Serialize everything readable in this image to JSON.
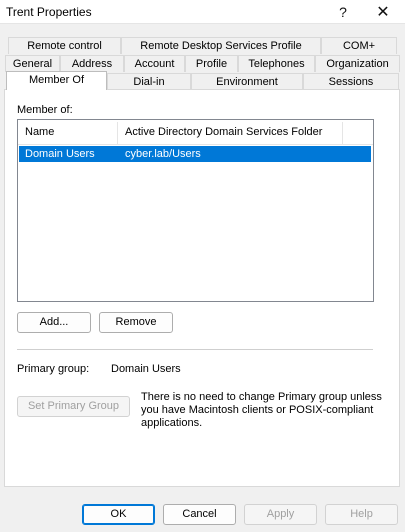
{
  "window": {
    "title": "Trent Properties",
    "help_glyph": "?",
    "close_glyph": "✕"
  },
  "tabs": {
    "row1": [
      "Remote control",
      "Remote Desktop Services Profile",
      "COM+"
    ],
    "row2": [
      "General",
      "Address",
      "Account",
      "Profile",
      "Telephones",
      "Organization"
    ],
    "row3": [
      "Member Of",
      "Dial-in",
      "Environment",
      "Sessions"
    ],
    "active": "Member Of"
  },
  "member_of": {
    "label": "Member of:",
    "columns": [
      "Name",
      "Active Directory Domain Services Folder"
    ],
    "rows": [
      {
        "name": "Domain Users",
        "folder": "cyber.lab/Users",
        "selected": true
      }
    ],
    "add_button": "Add...",
    "remove_button": "Remove"
  },
  "primary_group": {
    "label": "Primary group:",
    "value": "Domain Users",
    "set_button": "Set Primary Group",
    "note": "There is no need to change Primary group unless you have Macintosh clients or POSIX-compliant applications."
  },
  "footer": {
    "ok": "OK",
    "cancel": "Cancel",
    "apply": "Apply",
    "help": "Help"
  },
  "colors": {
    "selection": "#0078d7",
    "default_button_border": "#0078d7"
  }
}
